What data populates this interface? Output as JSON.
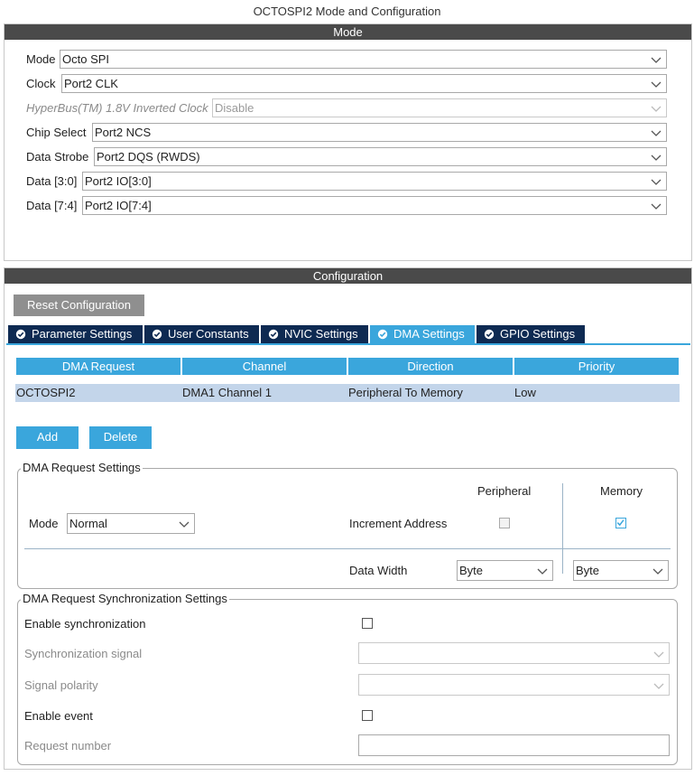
{
  "window": {
    "title": "OCTOSPI2 Mode and Configuration"
  },
  "mode_section": {
    "header": "Mode",
    "fields": [
      {
        "label": "Mode",
        "value": "Octo SPI",
        "disabled": false
      },
      {
        "label": "Clock",
        "value": "Port2 CLK",
        "disabled": false
      },
      {
        "label": "HyperBus(TM) 1.8V Inverted Clock",
        "value": "Disable",
        "disabled": true
      },
      {
        "label": "Chip Select",
        "value": "Port2 NCS",
        "disabled": false
      },
      {
        "label": "Data Strobe",
        "value": "Port2 DQS (RWDS)",
        "disabled": false
      },
      {
        "label": "Data [3:0]",
        "value": "Port2 IO[3:0]",
        "disabled": false
      },
      {
        "label": "Data [7:4]",
        "value": "Port2 IO[7:4]",
        "disabled": false
      }
    ]
  },
  "config_section": {
    "header": "Configuration",
    "reset_label": "Reset Configuration",
    "tabs": [
      {
        "label": "Parameter Settings",
        "active": false
      },
      {
        "label": "User Constants",
        "active": false
      },
      {
        "label": "NVIC Settings",
        "active": false
      },
      {
        "label": "DMA Settings",
        "active": true
      },
      {
        "label": "GPIO Settings",
        "active": false
      }
    ]
  },
  "dma_table": {
    "columns": [
      "DMA Request",
      "Channel",
      "Direction",
      "Priority"
    ],
    "rows": [
      [
        "OCTOSPI2",
        "DMA1 Channel 1",
        "Peripheral To Memory",
        "Low"
      ]
    ]
  },
  "actions": {
    "add_label": "Add",
    "delete_label": "Delete"
  },
  "dma_request_settings": {
    "legend": "DMA Request Settings",
    "peripheral_header": "Peripheral",
    "memory_header": "Memory",
    "mode_label": "Mode",
    "mode_value": "Normal",
    "increment_label": "Increment Address",
    "peripheral_increment": false,
    "memory_increment": true,
    "data_width_label": "Data Width",
    "peripheral_width": "Byte",
    "memory_width": "Byte"
  },
  "sync_settings": {
    "legend": "DMA Request Synchronization Settings",
    "enable_sync_label": "Enable synchronization",
    "enable_sync": false,
    "sync_signal_label": "Synchronization signal",
    "sync_signal_value": "",
    "polarity_label": "Signal polarity",
    "polarity_value": "",
    "enable_event_label": "Enable event",
    "enable_event": false,
    "request_number_label": "Request number",
    "request_number_value": ""
  },
  "colors": {
    "accent": "#3aa6dc",
    "tab_dark": "#0e2a52",
    "section_bar": "#4a4a4a",
    "row_selected": "#c3d5ea"
  }
}
